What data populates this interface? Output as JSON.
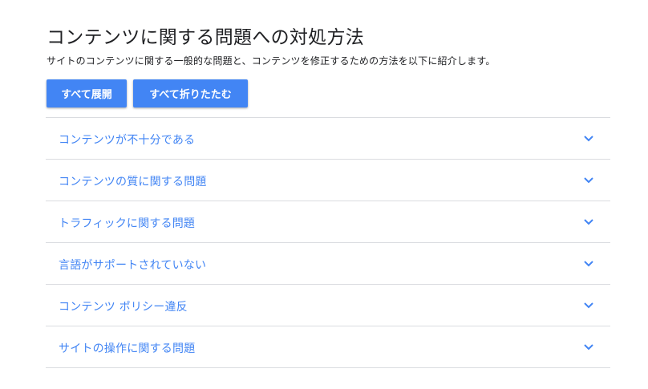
{
  "page": {
    "title": "コンテンツに関する問題への対処方法",
    "description": "サイトのコンテンツに関する一般的な問題と、コンテンツを修正するための方法を以下に紹介します。"
  },
  "buttons": {
    "expand_all": "すべて展開",
    "collapse_all": "すべて折りたたむ"
  },
  "accordion": {
    "items": [
      {
        "label": "コンテンツが不十分である",
        "icon": "chevron-down-icon"
      },
      {
        "label": "コンテンツの質に関する問題",
        "icon": "chevron-down-icon"
      },
      {
        "label": "トラフィックに関する問題",
        "icon": "chevron-down-icon"
      },
      {
        "label": "言語がサポートされていない",
        "icon": "chevron-down-icon"
      },
      {
        "label": "コンテンツ ポリシー違反",
        "icon": "chevron-down-icon"
      },
      {
        "label": "サイトの操作に関する問題",
        "icon": "chevron-down-icon"
      }
    ]
  },
  "colors": {
    "accent": "#4285f4",
    "text": "#202124",
    "divider": "#dadce0"
  }
}
